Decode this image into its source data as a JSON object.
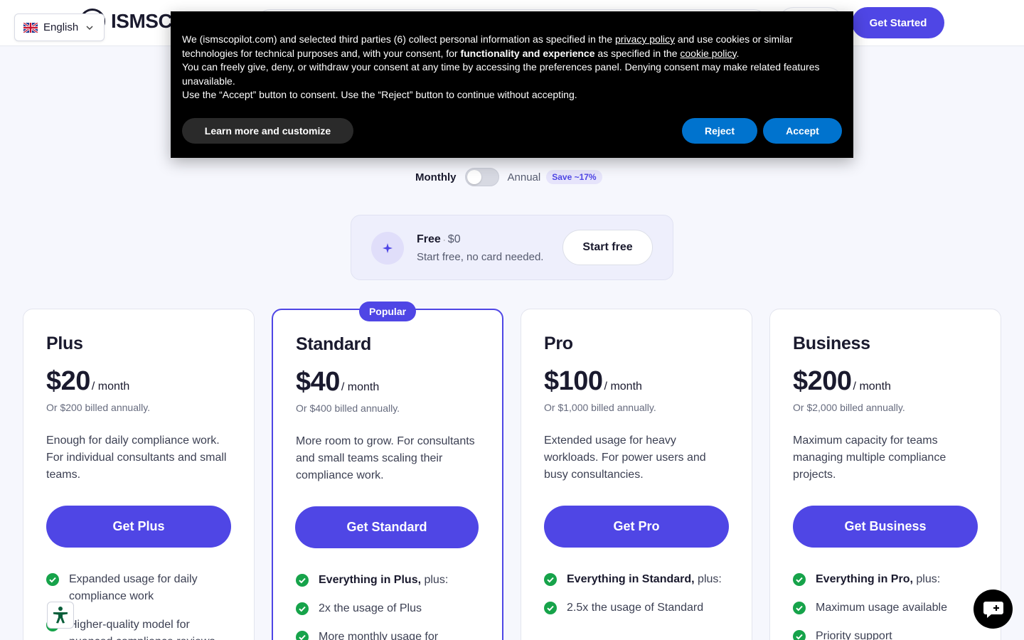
{
  "header": {
    "brand": "ISMSC",
    "get_started_label": "Get Started",
    "language": "English"
  },
  "cookie": {
    "text_intro": "We (ismscopilot.com) and selected third parties (6) collect personal information as specified in the ",
    "privacy_link": "privacy policy",
    "text_mid": " and use cookies or similar technologies for technical purposes and, with your consent, for ",
    "text_bold": "functionality and experience",
    "text_mid2": " as specified in the ",
    "cookie_link": "cookie policy",
    "text_end": ".",
    "text_line2": "You can freely give, deny, or withdraw your consent at any time by accessing the preferences panel. Denying consent may make related features unavailable.",
    "text_line3": "Use the “Accept” button to consent. Use the “Reject” button to continue without accepting.",
    "learn_label": "Learn more and customize",
    "reject_label": "Reject",
    "accept_label": "Accept"
  },
  "billing": {
    "monthly_label": "Monthly",
    "annual_label": "Annual",
    "save_badge": "Save ~17%",
    "annual_selected": false
  },
  "free": {
    "name": "Free",
    "separator": "·",
    "price": "$0",
    "subtitle": "Start free, no card needed.",
    "cta": "Start free"
  },
  "plans": [
    {
      "name": "Plus",
      "amount": "$20",
      "period": "/ month",
      "annual_note": "Or $200 billed annually.",
      "description": "Enough for daily compliance work. For individual consultants and small teams.",
      "cta": "Get Plus",
      "features": [
        {
          "bold": "",
          "text": "Expanded usage for daily compliance work"
        },
        {
          "bold": "",
          "text": "Higher-quality model for nuanced compliance reviews"
        }
      ]
    },
    {
      "name": "Standard",
      "amount": "$40",
      "period": "/ month",
      "annual_note": "Or $400 billed annually.",
      "description": "More room to grow. For consultants and small teams scaling their compliance work.",
      "cta": "Get Standard",
      "badge": "Popular",
      "features": [
        {
          "bold": "Everything in Plus,",
          "text": " plus:"
        },
        {
          "bold": "",
          "text": "2x the usage of Plus"
        },
        {
          "bold": "",
          "text": "More monthly usage for"
        }
      ]
    },
    {
      "name": "Pro",
      "amount": "$100",
      "period": "/ month",
      "annual_note": "Or $1,000 billed annually.",
      "description": "Extended usage for heavy workloads. For power users and busy consultancies.",
      "cta": "Get Pro",
      "features": [
        {
          "bold": "Everything in Standard,",
          "text": " plus:"
        },
        {
          "bold": "",
          "text": "2.5x the usage of Standard"
        }
      ]
    },
    {
      "name": "Business",
      "amount": "$200",
      "period": "/ month",
      "annual_note": "Or $2,000 billed annually.",
      "description": "Maximum capacity for teams managing multiple compliance projects.",
      "cta": "Get Business",
      "features": [
        {
          "bold": "Everything in Pro,",
          "text": " plus:"
        },
        {
          "bold": "",
          "text": "Maximum usage available"
        },
        {
          "bold": "",
          "text": "Priority support"
        }
      ]
    }
  ],
  "icons": {
    "accessibility": "accessibility-icon",
    "chat": "chat-icon",
    "check": "check-circle-icon",
    "sparkle": "sparkle-icon"
  },
  "colors": {
    "accent": "#4f46e5",
    "check": "#16a34a",
    "cookie_button": "#0073ce"
  }
}
